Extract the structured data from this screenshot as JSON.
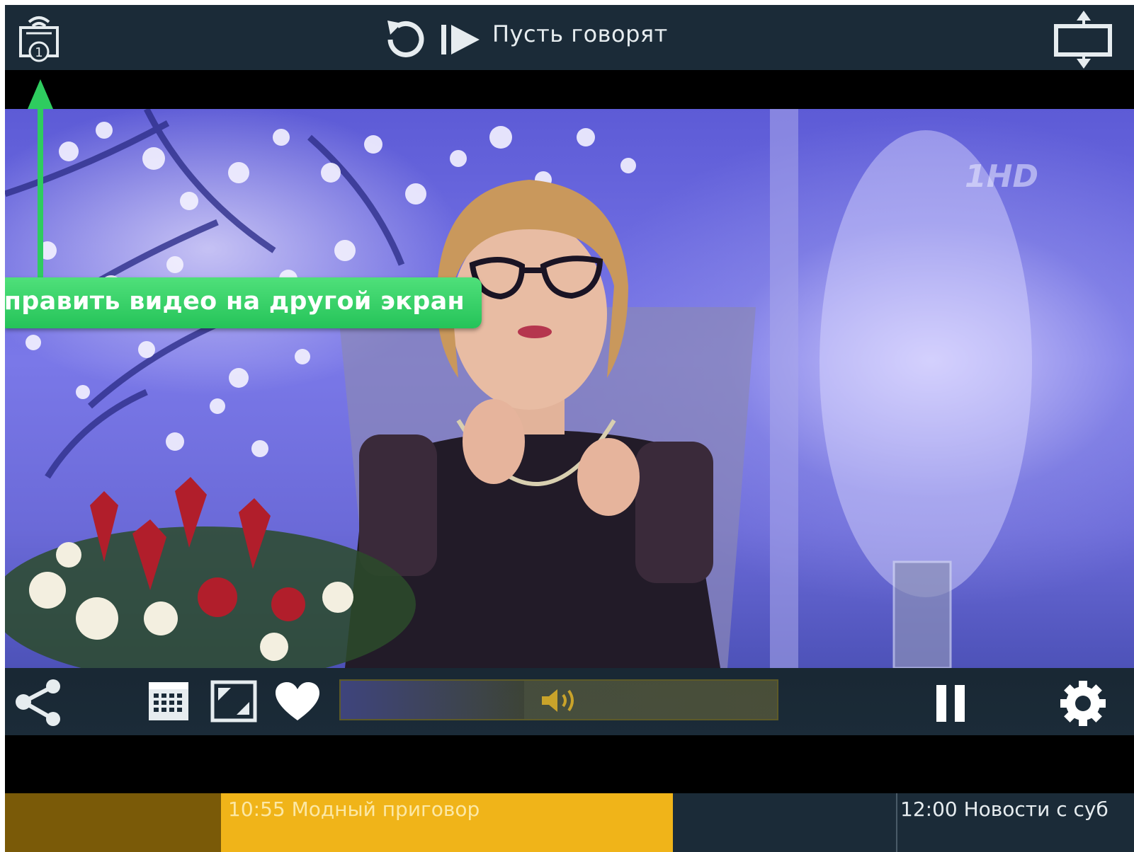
{
  "header": {
    "program_title": "Пусть говорят",
    "cast_badge": "1"
  },
  "video": {
    "channel_watermark": "1HD"
  },
  "controls": {
    "volume_level": 0.42
  },
  "epg": {
    "current": "10:55 Модный приговор",
    "next": "12:00 Новости с суб"
  },
  "hint": {
    "text": "тправить видео на другой экран"
  },
  "colors": {
    "bar_bg": "#1b2b38",
    "epg_current": "#f0b419",
    "epg_past": "#7a5a08",
    "hint_green": "#2ecc5f"
  },
  "icons": [
    "cast-icon",
    "replay-icon",
    "play-next-icon",
    "aspect-ratio-icon",
    "share-icon",
    "calendar-icon",
    "pip-icon",
    "heart-icon",
    "volume-icon",
    "pause-icon",
    "gear-icon"
  ]
}
